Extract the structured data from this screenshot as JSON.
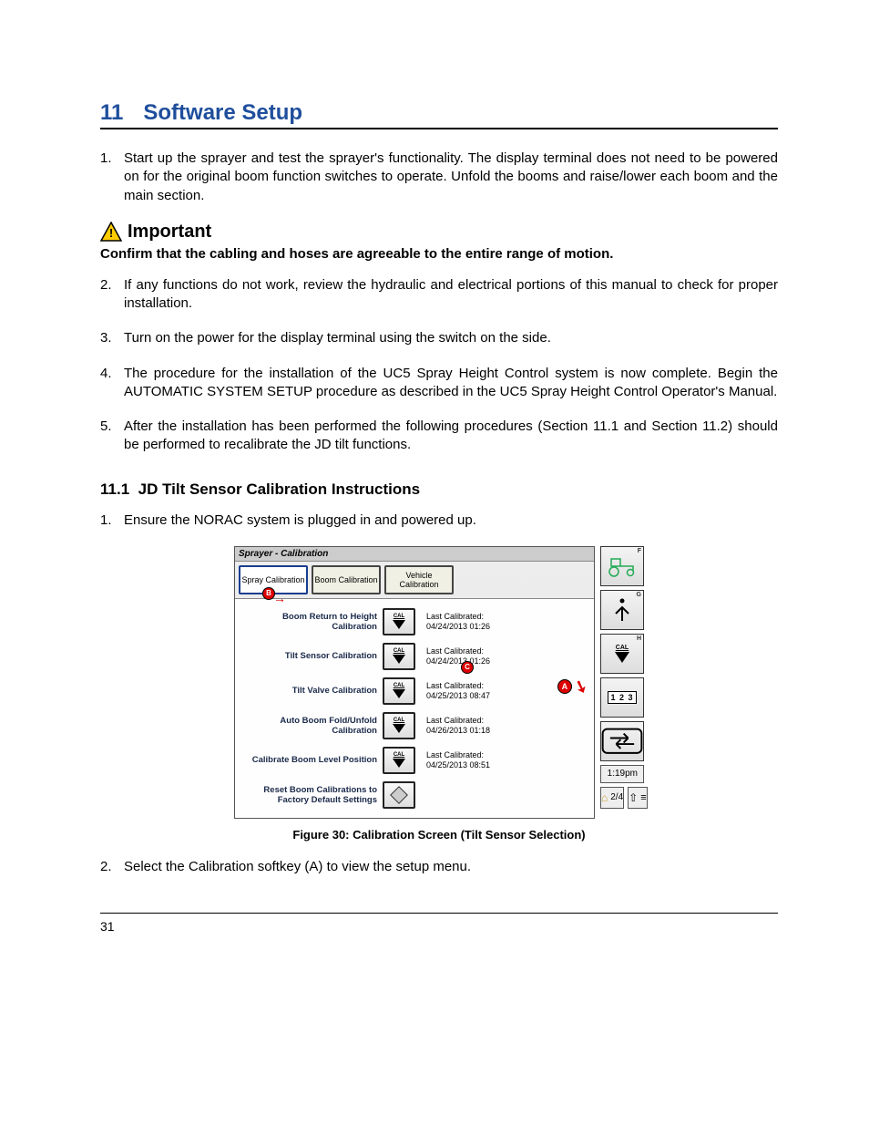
{
  "chapter": {
    "number": "11",
    "title": "Software Setup"
  },
  "list1": [
    "Start up the sprayer and test the sprayer's functionality.  The display terminal does not need to be powered on for the original boom function switches to operate.  Unfold the booms and raise/lower each boom and the main section."
  ],
  "important": {
    "label": "Important",
    "text": "Confirm that the cabling and hoses are agreeable to the entire range of motion."
  },
  "list1b": [
    "If any functions do not work, review the hydraulic and electrical portions of this manual to check for proper installation.",
    "Turn on the power for the display terminal using the switch on the side.",
    "The procedure for the installation of the UC5 Spray Height Control system is now complete.  Begin the AUTOMATIC SYSTEM SETUP procedure as described in the UC5 Spray Height Control Operator's Manual.",
    "After the installation has been performed the following procedures (Section 11.1 and Section 11.2) should be performed to recalibrate the JD tilt functions."
  ],
  "sub": {
    "number": "11.1",
    "title": "JD Tilt Sensor Calibration Instructions"
  },
  "list2": [
    "Ensure the NORAC system is plugged in and powered up.",
    "Select the Calibration softkey (A) to view the setup menu."
  ],
  "figure": {
    "caption": "Figure 30:  Calibration Screen (Tilt Sensor Selection)",
    "screenTitle": "Sprayer - Calibration",
    "tabs": [
      "Spray Calibration",
      "Boom Calibration",
      "Vehicle Calibration"
    ],
    "markerB": "B",
    "markerC": "C",
    "markerA": "A",
    "items": [
      {
        "label": "Boom Return to Height Calibration",
        "btn": "CAL",
        "last": "Last Calibrated:",
        "date": "04/24/2013  01:26"
      },
      {
        "label": "Tilt Sensor Calibration",
        "btn": "CAL",
        "last": "Last Calibrated:",
        "date": "04/24/2013  01:26"
      },
      {
        "label": "Tilt Valve Calibration",
        "btn": "CAL",
        "last": "Last Calibrated:",
        "date": "04/25/2013  08:47"
      },
      {
        "label": "Auto Boom Fold/Unfold Calibration",
        "btn": "CAL",
        "last": "Last Calibrated:",
        "date": "04/26/2013  01:18"
      },
      {
        "label": "Calibrate Boom Level Position",
        "btn": "CAL",
        "last": "Last Calibrated:",
        "date": "04/25/2013  08:51"
      },
      {
        "label": "Reset Boom Calibrations to Factory Default Settings",
        "btn": "",
        "last": "",
        "date": ""
      }
    ],
    "side": {
      "F": "F",
      "G": "G",
      "H": "H",
      "calText": "CAL",
      "n123": "1 2 3",
      "time": "1:19pm",
      "pager": "2/4"
    }
  },
  "pageNumber": "31"
}
